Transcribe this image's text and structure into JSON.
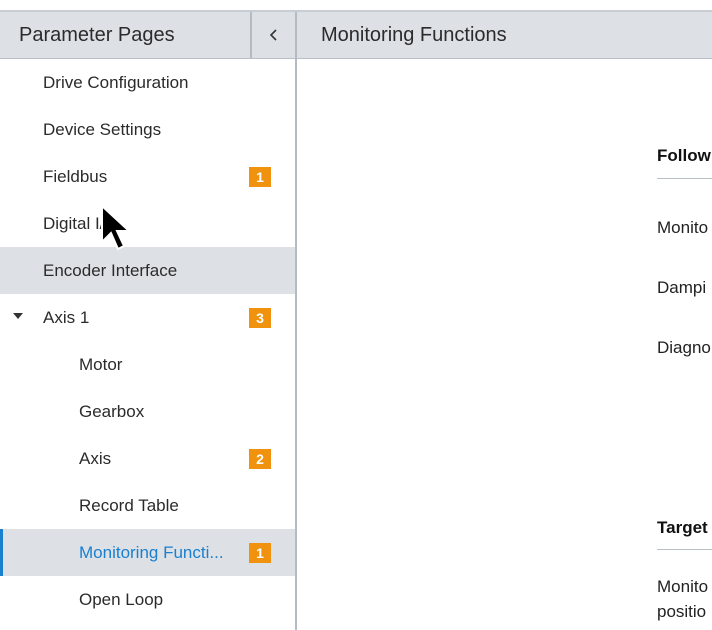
{
  "left_panel": {
    "title": "Parameter Pages",
    "collapse_icon": "chevron-left-icon",
    "items": [
      {
        "label": "Drive Configuration",
        "level": 0
      },
      {
        "label": "Device Settings",
        "level": 0
      },
      {
        "label": "Fieldbus",
        "level": 0,
        "badge": "1"
      },
      {
        "label": "Digital I/O",
        "level": 0
      },
      {
        "label": "Encoder Interface",
        "level": 0,
        "state": "hover"
      },
      {
        "label": "Axis 1",
        "level": 0,
        "badge": "3",
        "expanded": true
      },
      {
        "label": "Motor",
        "level": 1
      },
      {
        "label": "Gearbox",
        "level": 1
      },
      {
        "label": "Axis",
        "level": 1,
        "badge": "2"
      },
      {
        "label": "Record Table",
        "level": 1
      },
      {
        "label": "Monitoring Functi...",
        "level": 1,
        "badge": "1",
        "state": "selected"
      },
      {
        "label": "Open Loop",
        "level": 1
      }
    ]
  },
  "right_panel": {
    "title": "Monitoring Functions",
    "sections": [
      {
        "title": "Follow",
        "fields": [
          "Monito",
          "Dampi",
          "Diagno"
        ]
      },
      {
        "title": "Target",
        "fields": [
          "Monito",
          "positio"
        ]
      }
    ]
  },
  "colors": {
    "header_bg": "#dde1e6",
    "accent": "#1a7fcf",
    "badge": "#f0920e"
  }
}
